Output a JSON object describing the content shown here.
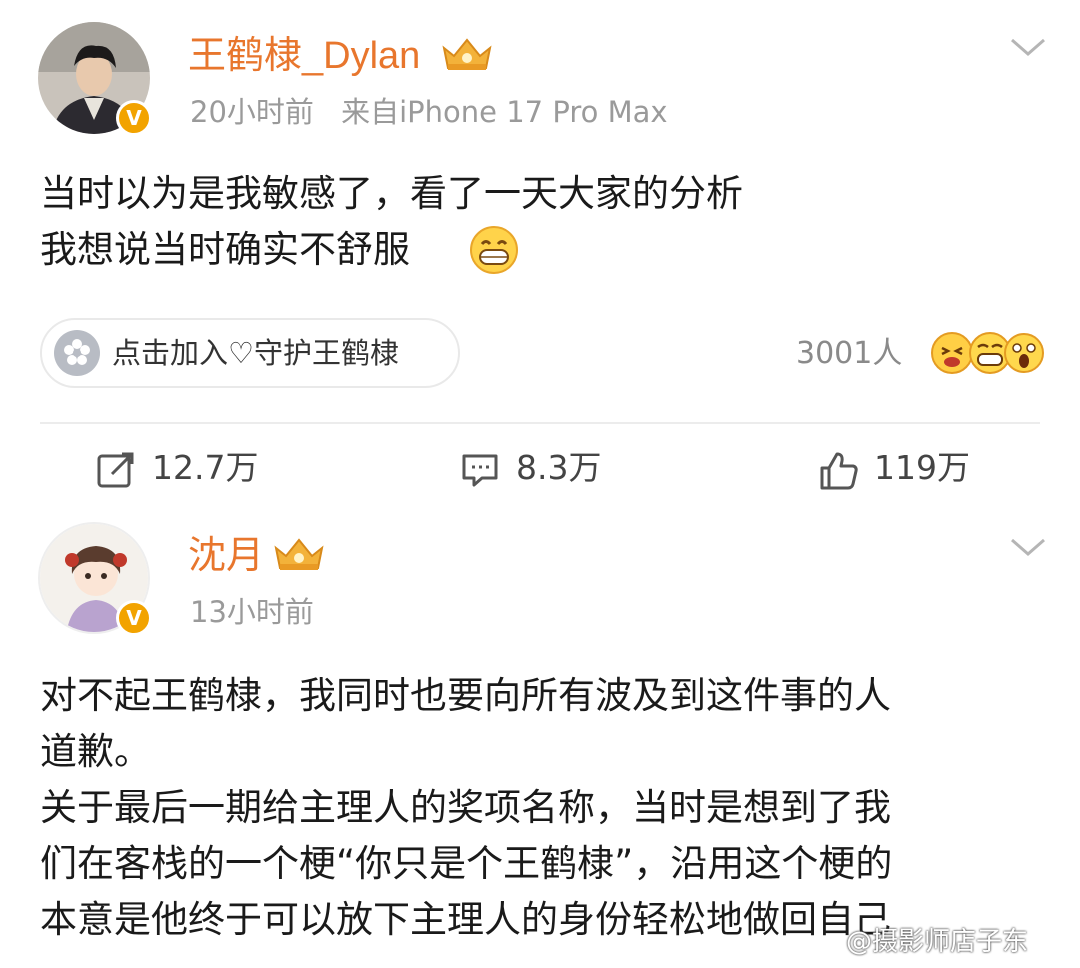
{
  "post1": {
    "username": "王鹤棣_Dylan",
    "time": "20小时前",
    "source": "来自iPhone 17 Pro Max",
    "text_lines": [
      "当时以为是我敏感了，看了一天大家的分析",
      "我想说当时确实不舒服"
    ],
    "fan_pill_label": "点击加入♡守护王鹤棣",
    "reaction_count": "3001人",
    "actions": {
      "repost": "12.7万",
      "comment": "8.3万",
      "like": "119万"
    }
  },
  "post2": {
    "username": "沈月",
    "time": "13小时前",
    "text_lines": [
      "对不起王鹤棣，我同时也要向所有波及到这件事的人",
      "道歉。",
      "关于最后一期给主理人的奖项名称，当时是想到了我",
      "们在客栈的一个梗“你只是个王鹤棣”，沿用这个梗的",
      "本意是他终于可以放下主理人的身份轻松地做回自己"
    ]
  },
  "badge_letter": "V",
  "watermark": "@摄影师店子东",
  "colors": {
    "username": "#e8762d",
    "verified": "#f2a300",
    "meta": "#9a9a9a"
  },
  "icons": [
    "chevron-down-icon",
    "crown-badge-icon",
    "verified-badge-icon",
    "grin-emoji-icon",
    "repost-icon",
    "comment-icon",
    "like-icon"
  ]
}
